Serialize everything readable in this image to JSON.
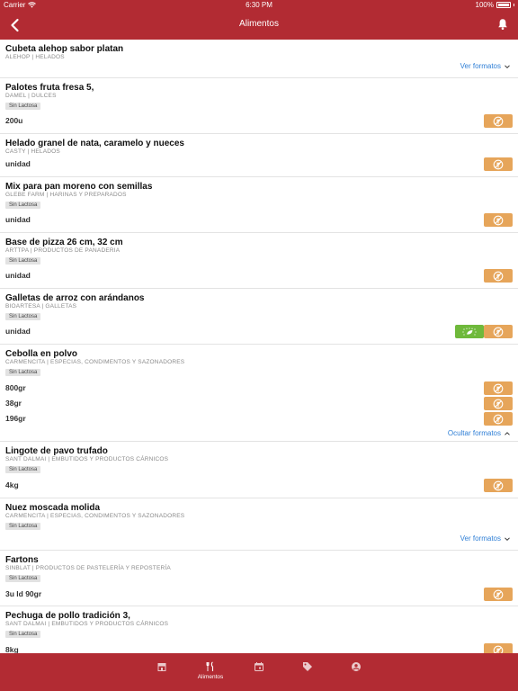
{
  "status_bar": {
    "carrier": "Carrier",
    "time": "6:30 PM",
    "battery": "100%"
  },
  "header": {
    "title": "Alimentos"
  },
  "products": [
    {
      "name": "Cubeta alehop sabor platan",
      "meta": "ALEHOP | HELADOS",
      "toggle": "Ver formatos"
    },
    {
      "name": "Palotes fruta fresa 5,",
      "meta": "DAMEL | DULCES",
      "tag": "Sin Lactosa",
      "formats": [
        "200u"
      ]
    },
    {
      "name": "Helado granel de nata, caramelo y nueces",
      "meta": "CASTY | HELADOS",
      "formats": [
        "unidad"
      ]
    },
    {
      "name": "Mix para pan moreno con semillas",
      "meta": "GLEBE FARM | HARINAS Y PREPARADOS",
      "tag": "Sin Lactosa",
      "formats": [
        "unidad"
      ]
    },
    {
      "name": "Base de pizza 26 cm, 32 cm",
      "meta": "ARTTPA | PRODUCTOS DE PANADERIA",
      "tag": "Sin Lactosa",
      "formats": [
        "unidad"
      ]
    },
    {
      "name": "Galletas de arroz con arándanos",
      "meta": "BIOARTESA | GALLETAS",
      "tag": "Sin Lactosa",
      "formats": [
        "unidad"
      ]
    },
    {
      "name": "Cebolla en polvo",
      "meta": "CARMENCITA | ESPECIAS, CONDIMENTOS Y SAZONADORES",
      "tag": "Sin Lactosa",
      "formats": [
        "800gr",
        "38gr",
        "196gr"
      ],
      "toggle": "Ocultar formatos"
    },
    {
      "name": "Lingote de pavo trufado",
      "meta": "SANT DALMAI | EMBUTIDOS Y PRODUCTOS CÁRNICOS",
      "tag": "Sin Lactosa",
      "formats": [
        "4kg"
      ]
    },
    {
      "name": "Nuez moscada molida",
      "meta": "CARMENCITA | ESPECIAS, CONDIMENTOS Y SAZONADORES",
      "tag": "Sin Lactosa",
      "toggle": "Ver formatos"
    },
    {
      "name": "Fartons",
      "meta": "SINBLAT | PRODUCTOS DE PASTELERÍA Y REPOSTERÍA",
      "tag": "Sin Lactosa",
      "formats": [
        "3u ld 90gr"
      ]
    },
    {
      "name": "Pechuga de pollo tradición 3,",
      "meta": "SANT DALMAI | EMBUTIDOS Y PRODUCTOS CÁRNICOS",
      "tag": "Sin Lactosa",
      "formats": [
        "8kg"
      ]
    }
  ],
  "tabbar": {
    "tabs": [
      {
        "label": ""
      },
      {
        "label": "Alimentos"
      },
      {
        "label": ""
      },
      {
        "label": ""
      },
      {
        "label": ""
      }
    ]
  },
  "colors": {
    "brand_red": "#b22b33",
    "link_blue": "#2f7fd6",
    "gluten_free_badge": "#e6a55a",
    "eco_badge": "#6fb93b"
  },
  "icons": {
    "back": "chevron-left-icon",
    "notifications": "bell-icon",
    "gluten_free": "no-wheat-icon",
    "eco": "eu-organic-leaf-icon"
  }
}
